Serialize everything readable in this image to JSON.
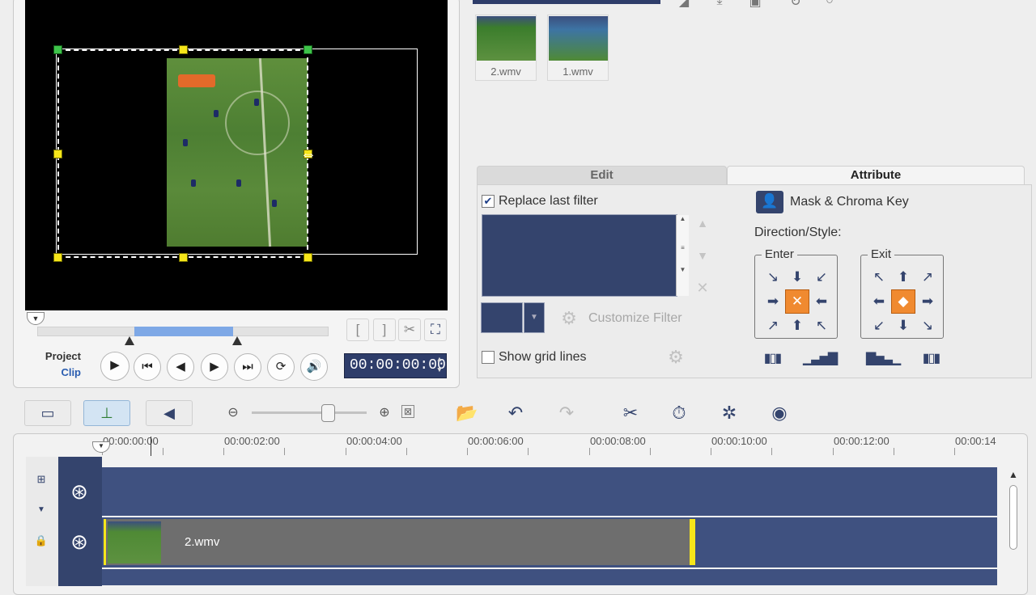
{
  "preview": {
    "mode_project": "Project",
    "mode_clip": "Clip",
    "timecode": "00:00:00:00",
    "scrub_head_label": "▼",
    "mark_in_label": "[",
    "mark_out_label": "]",
    "cut_label": "✂",
    "fit_label": "⛶"
  },
  "library": {
    "clips": [
      {
        "name": "2.wmv"
      },
      {
        "name": "1.wmv"
      }
    ]
  },
  "options": {
    "tabs": [
      "Edit",
      "Attribute"
    ],
    "active_tab": "Attribute",
    "replace_last_filter": {
      "label": "Replace last filter",
      "checked": true
    },
    "customize_filter": "Customize Filter",
    "show_grid_lines": {
      "label": "Show grid lines",
      "checked": false
    },
    "mask_chroma_key": "Mask & Chroma Key",
    "direction_style": "Direction/Style:",
    "enter_label": "Enter",
    "exit_label": "Exit"
  },
  "timeline": {
    "ruler_labels": [
      "00:00:00:00",
      "00:00:02:00",
      "00:00:04:00",
      "00:00:06:00",
      "00:00:08:00",
      "00:00:10:00",
      "00:00:12:00",
      "00:00:14"
    ],
    "overlay_clip_name": "2.wmv"
  },
  "colors": {
    "accent": "#34446d",
    "handle": "#f6e61a",
    "active_direction": "#f08a30"
  }
}
